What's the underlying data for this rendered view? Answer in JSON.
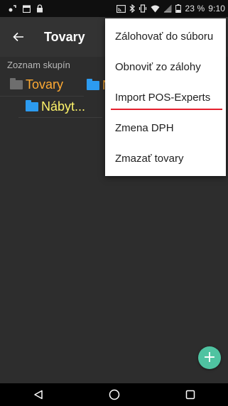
{
  "status_bar": {
    "battery_percent": "23 %",
    "time": "9:10",
    "icons": [
      "notification-icon",
      "calendar-icon",
      "lock-icon",
      "cast-icon",
      "bluetooth-icon",
      "vibrate-icon",
      "wifi-icon",
      "signal-icon",
      "battery-icon"
    ]
  },
  "app_bar": {
    "title": "Tovary",
    "back_icon": "arrow-back-icon"
  },
  "content": {
    "group_list_label": "Zoznam skupín",
    "folders": [
      {
        "label": "Tovary",
        "color": "#ffaa33"
      },
      {
        "label": "Nábyt...",
        "color": "#fff46a"
      }
    ],
    "partial_folder_label": "N"
  },
  "menu": {
    "items": [
      {
        "label": "Zálohovať do súboru"
      },
      {
        "label": "Obnoviť zo zálohy"
      },
      {
        "label": "Import POS-Experts",
        "annotated": true
      },
      {
        "label": "Zmena DPH"
      },
      {
        "label": "Zmazať tovary"
      }
    ]
  },
  "fab": {
    "label": "+",
    "color": "#4fc3a1"
  },
  "nav_bar": {
    "buttons": [
      "back-triangle-icon",
      "home-circle-icon",
      "recents-square-icon"
    ]
  },
  "colors": {
    "annotation_underline": "#e5202e",
    "folder_icon": "#2c9bf0",
    "background": "#2d2d2d"
  }
}
